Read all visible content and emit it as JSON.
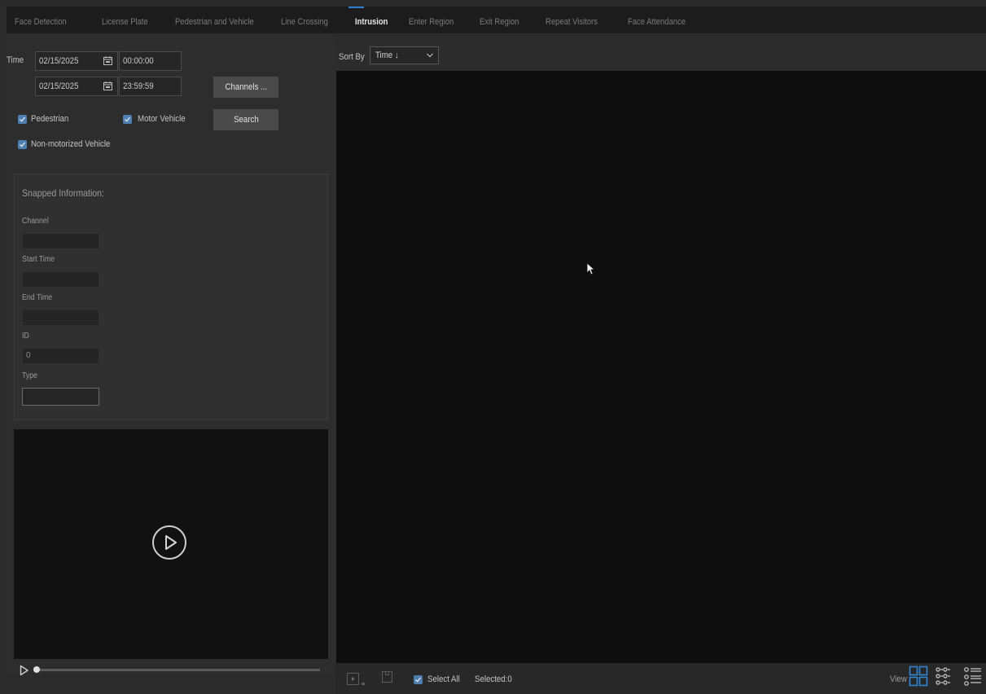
{
  "tabs": [
    {
      "label": "Face Detection",
      "active": false
    },
    {
      "label": "License Plate",
      "active": false
    },
    {
      "label": "Pedestrian and Vehicle",
      "active": false
    },
    {
      "label": "Line Crossing",
      "active": false
    },
    {
      "label": "Intrusion",
      "active": true
    },
    {
      "label": "Enter Region",
      "active": false
    },
    {
      "label": "Exit Region",
      "active": false
    },
    {
      "label": "Repeat Visitors",
      "active": false
    },
    {
      "label": "Face Attendance",
      "active": false
    }
  ],
  "filters": {
    "time_label": "Time",
    "start_date": "02/15/2025",
    "start_time": "00:00:00",
    "end_date": "02/15/2025",
    "end_time": "23:59:59",
    "channels_button": "Channels ...",
    "search_button": "Search",
    "pedestrian": {
      "label": "Pedestrian",
      "checked": true
    },
    "motor_vehicle": {
      "label": "Motor Vehicle",
      "checked": true
    },
    "non_motorized": {
      "label": "Non-motorized Vehicle",
      "checked": true
    }
  },
  "snapped": {
    "title": "Snapped Information:",
    "channel_label": "Channel",
    "channel_value": "",
    "start_label": "Start Time",
    "start_value": "",
    "end_label": "End Time",
    "end_value": "",
    "id_label": "ID",
    "id_value": "0",
    "type_label": "Type",
    "type_value": ""
  },
  "sort": {
    "label": "Sort By",
    "value": "Time ↓"
  },
  "bottom": {
    "select_all_label": "Select All",
    "select_all_checked": true,
    "selected_text": "Selected:0",
    "view_label": "View"
  },
  "player": {
    "progress": 0.0
  },
  "colors": {
    "accent": "#2f7fd1",
    "checkbox": "#4e7fb1"
  }
}
